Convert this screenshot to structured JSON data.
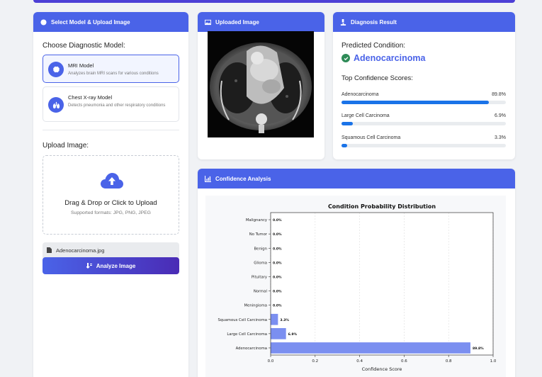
{
  "left_panel": {
    "header": "Select Model & Upload Image",
    "choose_title": "Choose Diagnostic Model:",
    "models": [
      {
        "name": "MRI Model",
        "desc": "Analyzes brain MRI scans for various conditions",
        "icon": "brain-icon"
      },
      {
        "name": "Chest X-ray Model",
        "desc": "Detects pneumonia and other respiratory conditions",
        "icon": "lungs-icon"
      }
    ],
    "upload_title": "Upload Image:",
    "dropzone": {
      "title": "Drag & Drop or Click to Upload",
      "sub": "Supported formats: JPG, PNG, JPEG"
    },
    "file_name": "Adenocarcinoma.jpg",
    "analyze_label": "Analyze Image"
  },
  "image_panel": {
    "header": "Uploaded Image"
  },
  "diagnosis_panel": {
    "header": "Diagnosis Result",
    "predicted_label": "Predicted Condition:",
    "predicted_value": "Adenocarcinoma",
    "top_label": "Top Confidence Scores:",
    "scores": [
      {
        "name": "Adenocarcinoma",
        "value": "89.8%",
        "pct": 89.8
      },
      {
        "name": "Large Cell Carcinoma",
        "value": "6.9%",
        "pct": 6.9
      },
      {
        "name": "Squamous Cell Carcinoma",
        "value": "3.3%",
        "pct": 3.3
      }
    ]
  },
  "confidence_panel": {
    "header": "Confidence Analysis"
  },
  "chart_data": {
    "type": "bar",
    "orientation": "horizontal",
    "title": "Condition Probability Distribution",
    "xlabel": "Confidence Score",
    "ylabel": "",
    "xlim": [
      0,
      1.0
    ],
    "xticks": [
      "0.0",
      "0.2",
      "0.4",
      "0.6",
      "0.8",
      "1.0"
    ],
    "grid": "vertical dashed",
    "categories": [
      "Malignancy",
      "No Tumor",
      "Benign",
      "Glioma",
      "Pituitary",
      "Normal",
      "Meningioma",
      "Squamous Cell Carcinoma",
      "Large Cell Carcinoma",
      "Adenocarcinoma"
    ],
    "values": [
      0.0,
      0.0,
      0.0,
      0.0,
      0.0,
      0.0,
      0.0,
      0.033,
      0.069,
      0.898
    ],
    "labels": [
      "0.0%",
      "0.0%",
      "0.0%",
      "0.0%",
      "0.0%",
      "0.0%",
      "0.0%",
      "3.3%",
      "6.9%",
      "89.8%"
    ],
    "bar_color": "#7b8ff0"
  },
  "colors": {
    "accent": "#4a63e8",
    "success": "#2e8b57",
    "score_bar": "#1a73e8"
  }
}
